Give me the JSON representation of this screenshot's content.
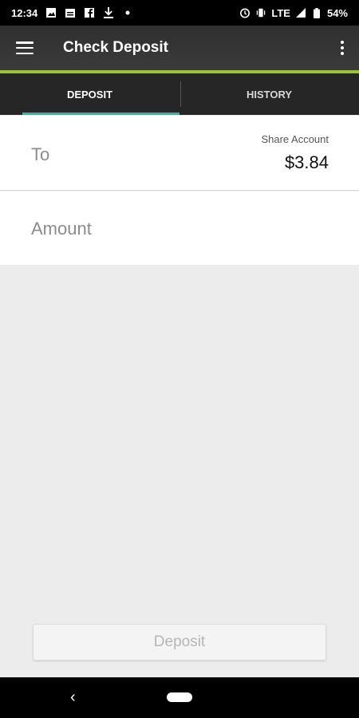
{
  "status_bar": {
    "time": "12:34",
    "network": "LTE",
    "battery": "54%",
    "icons_left": [
      "image-icon",
      "calendar-icon",
      "facebook-icon",
      "download-icon",
      "dot-icon"
    ],
    "icons_right": [
      "alarm-icon",
      "vibrate-icon",
      "signal-icon",
      "battery-icon"
    ]
  },
  "app_bar": {
    "title": "Check Deposit",
    "accent_color": "#9bc43c"
  },
  "tabs": [
    {
      "label": "DEPOSIT",
      "active": true
    },
    {
      "label": "HISTORY",
      "active": false
    }
  ],
  "form": {
    "to_label": "To",
    "account_name": "Share Account",
    "account_balance": "$3.84",
    "amount_label": "Amount"
  },
  "deposit_button": {
    "label": "Deposit",
    "enabled": false
  },
  "nav_bar": {
    "back_glyph": "‹"
  }
}
